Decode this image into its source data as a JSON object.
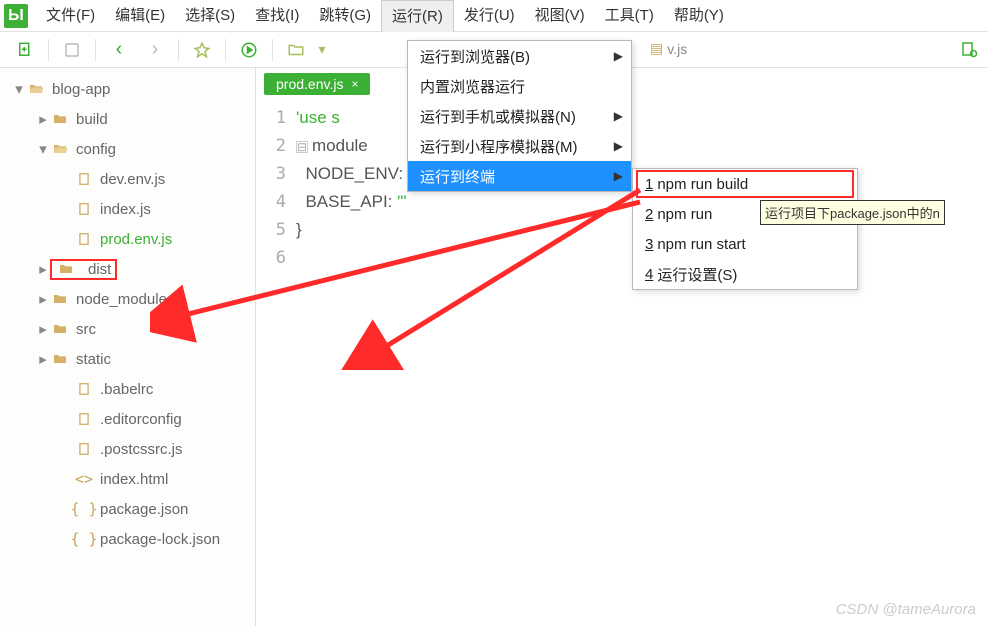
{
  "menubar": {
    "items": [
      {
        "label": "文件(F)"
      },
      {
        "label": "编辑(E)"
      },
      {
        "label": "选择(S)"
      },
      {
        "label": "查找(I)"
      },
      {
        "label": "跳转(G)"
      },
      {
        "label": "运行(R)",
        "active": true
      },
      {
        "label": "发行(U)"
      },
      {
        "label": "视图(V)"
      },
      {
        "label": "工具(T)"
      },
      {
        "label": "帮助(Y)"
      }
    ]
  },
  "toolbar": {
    "back": "‹",
    "forward": "›"
  },
  "breadcrumb": "v.js",
  "sidebar": {
    "tree": [
      {
        "depth": 0,
        "chev": "v",
        "icon": "folder-open",
        "label": "blog-app"
      },
      {
        "depth": 1,
        "chev": ">",
        "icon": "folder",
        "label": "build"
      },
      {
        "depth": 1,
        "chev": "v",
        "icon": "folder-open",
        "label": "config"
      },
      {
        "depth": 2,
        "chev": "",
        "icon": "file",
        "label": "dev.env.js"
      },
      {
        "depth": 2,
        "chev": "",
        "icon": "file",
        "label": "index.js"
      },
      {
        "depth": 2,
        "chev": "",
        "icon": "file",
        "label": "prod.env.js",
        "active": true
      },
      {
        "depth": 1,
        "chev": ">",
        "icon": "folder",
        "label": "dist",
        "highlight": true
      },
      {
        "depth": 1,
        "chev": ">",
        "icon": "folder",
        "label": "node_modules"
      },
      {
        "depth": 1,
        "chev": ">",
        "icon": "folder",
        "label": "src"
      },
      {
        "depth": 1,
        "chev": ">",
        "icon": "folder",
        "label": "static"
      },
      {
        "depth": 2,
        "chev": "",
        "icon": "file",
        "label": ".babelrc"
      },
      {
        "depth": 2,
        "chev": "",
        "icon": "file",
        "label": ".editorconfig"
      },
      {
        "depth": 2,
        "chev": "",
        "icon": "file",
        "label": ".postcssrc.js"
      },
      {
        "depth": 2,
        "chev": "",
        "icon": "code",
        "label": "index.html"
      },
      {
        "depth": 2,
        "chev": "",
        "icon": "braces",
        "label": "package.json"
      },
      {
        "depth": 2,
        "chev": "",
        "icon": "braces",
        "label": "package-lock.json"
      }
    ]
  },
  "editor": {
    "tab_label": "prod.env.js",
    "tab_close": "×",
    "lines": [
      {
        "n": "1",
        "html": "<span class='str'>'use s</span>"
      },
      {
        "n": "2",
        "html": "<span class='fold'>⊟</span><span class='property'>module</span>"
      },
      {
        "n": "3",
        "html": "&nbsp;&nbsp;<span class='property'>NODE_ENV</span>: <span class='str'>'\"production\"</span>"
      },
      {
        "n": "4",
        "html": "&nbsp;&nbsp;<span class='property'>BASE_API</span>: <span class='str'>'\"</span>"
      },
      {
        "n": "5",
        "html": "}"
      },
      {
        "n": "6",
        "html": ""
      }
    ]
  },
  "run_menu": {
    "items": [
      {
        "label": "运行到浏览器(B)",
        "sub": true
      },
      {
        "label": "内置浏览器运行",
        "sub": false
      },
      {
        "label": "运行到手机或模拟器(N)",
        "sub": true
      },
      {
        "label": "运行到小程序模拟器(M)",
        "sub": true
      },
      {
        "label": "运行到终端",
        "sub": true,
        "selected": true
      }
    ]
  },
  "sub_menu": {
    "items": [
      {
        "num": "1",
        "label": "npm run build",
        "hl": true
      },
      {
        "num": "2",
        "label": "npm run"
      },
      {
        "num": "3",
        "label": "npm run start"
      },
      {
        "num": "4",
        "label": "运行设置(S)"
      }
    ]
  },
  "tooltip": "运行项目下package.json中的n",
  "watermark": "CSDN @tameAurora"
}
